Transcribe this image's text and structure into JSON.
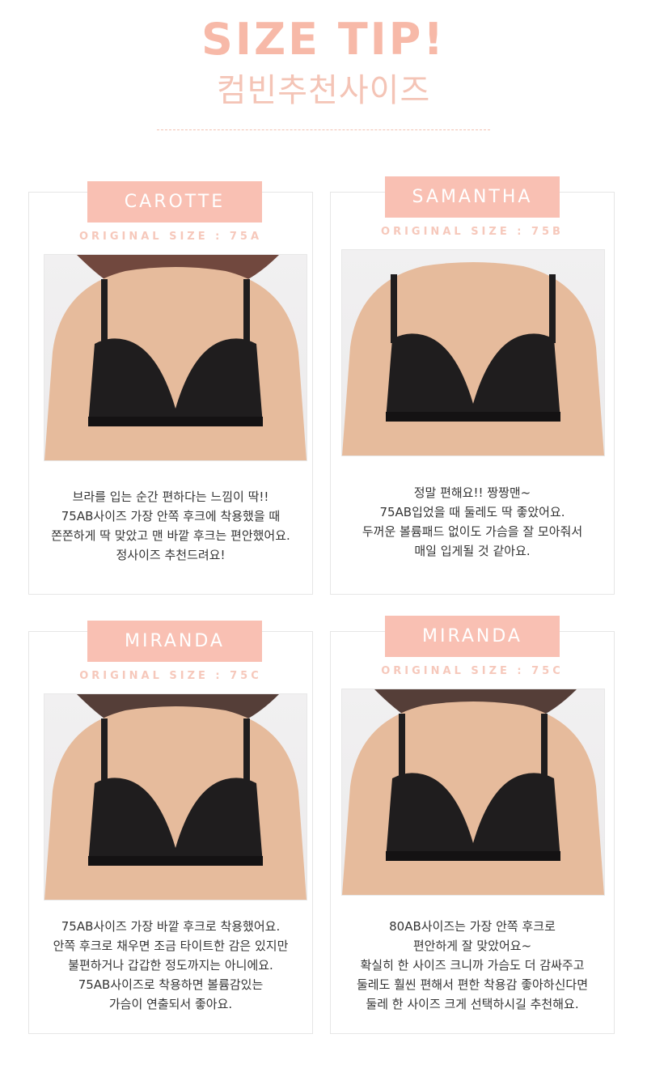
{
  "header": {
    "title": "SIZE TIP!",
    "subtitle": "컴빈추천사이즈"
  },
  "colors": {
    "accent": "#f9c0b3",
    "skin": "#e6bb9c",
    "bra": "#1f1d1e"
  },
  "cards": [
    {
      "name": "CAROTTE",
      "original_size": "ORIGINAL SIZE : 75A",
      "review_lines": [
        "브라를 입는 순간 편하다는 느낌이 딱!!",
        "75AB사이즈 가장 안쪽 후크에 착용했을 때",
        "쫀쫀하게 딱 맞았고 맨 바깥 후크는 편안했어요.",
        "정사이즈 추천드려요!"
      ]
    },
    {
      "name": "SAMANTHA",
      "original_size": "ORIGINAL SIZE : 75B",
      "review_lines": [
        "정말 편해요!! 짱짱맨~",
        "75AB입었을 때 둘레도 딱 좋았어요.",
        "두꺼운 볼륨패드 없이도 가슴을 잘 모아줘서",
        "매일 입게될 것 같아요."
      ]
    },
    {
      "name": "MIRANDA",
      "original_size": "ORIGINAL SIZE : 75C",
      "review_lines": [
        "75AB사이즈 가장 바깥 후크로 착용했어요.",
        "안쪽 후크로 채우면 조금 타이트한 감은 있지만",
        "불편하거나 갑갑한 정도까지는 아니에요.",
        "75AB사이즈로 착용하면 볼륨감있는",
        "가슴이 연출되서 좋아요."
      ]
    },
    {
      "name": "MIRANDA",
      "original_size": "ORIGINAL SIZE : 75C",
      "review_lines": [
        "80AB사이즈는 가장 안쪽 후크로",
        "편안하게 잘 맞았어요~",
        "확실히 한 사이즈 크니까 가슴도 더 감싸주고",
        "둘레도 훨씬 편해서 편한 착용감 좋아하신다면",
        "둘레 한 사이즈 크게 선택하시길 추천해요."
      ]
    }
  ]
}
